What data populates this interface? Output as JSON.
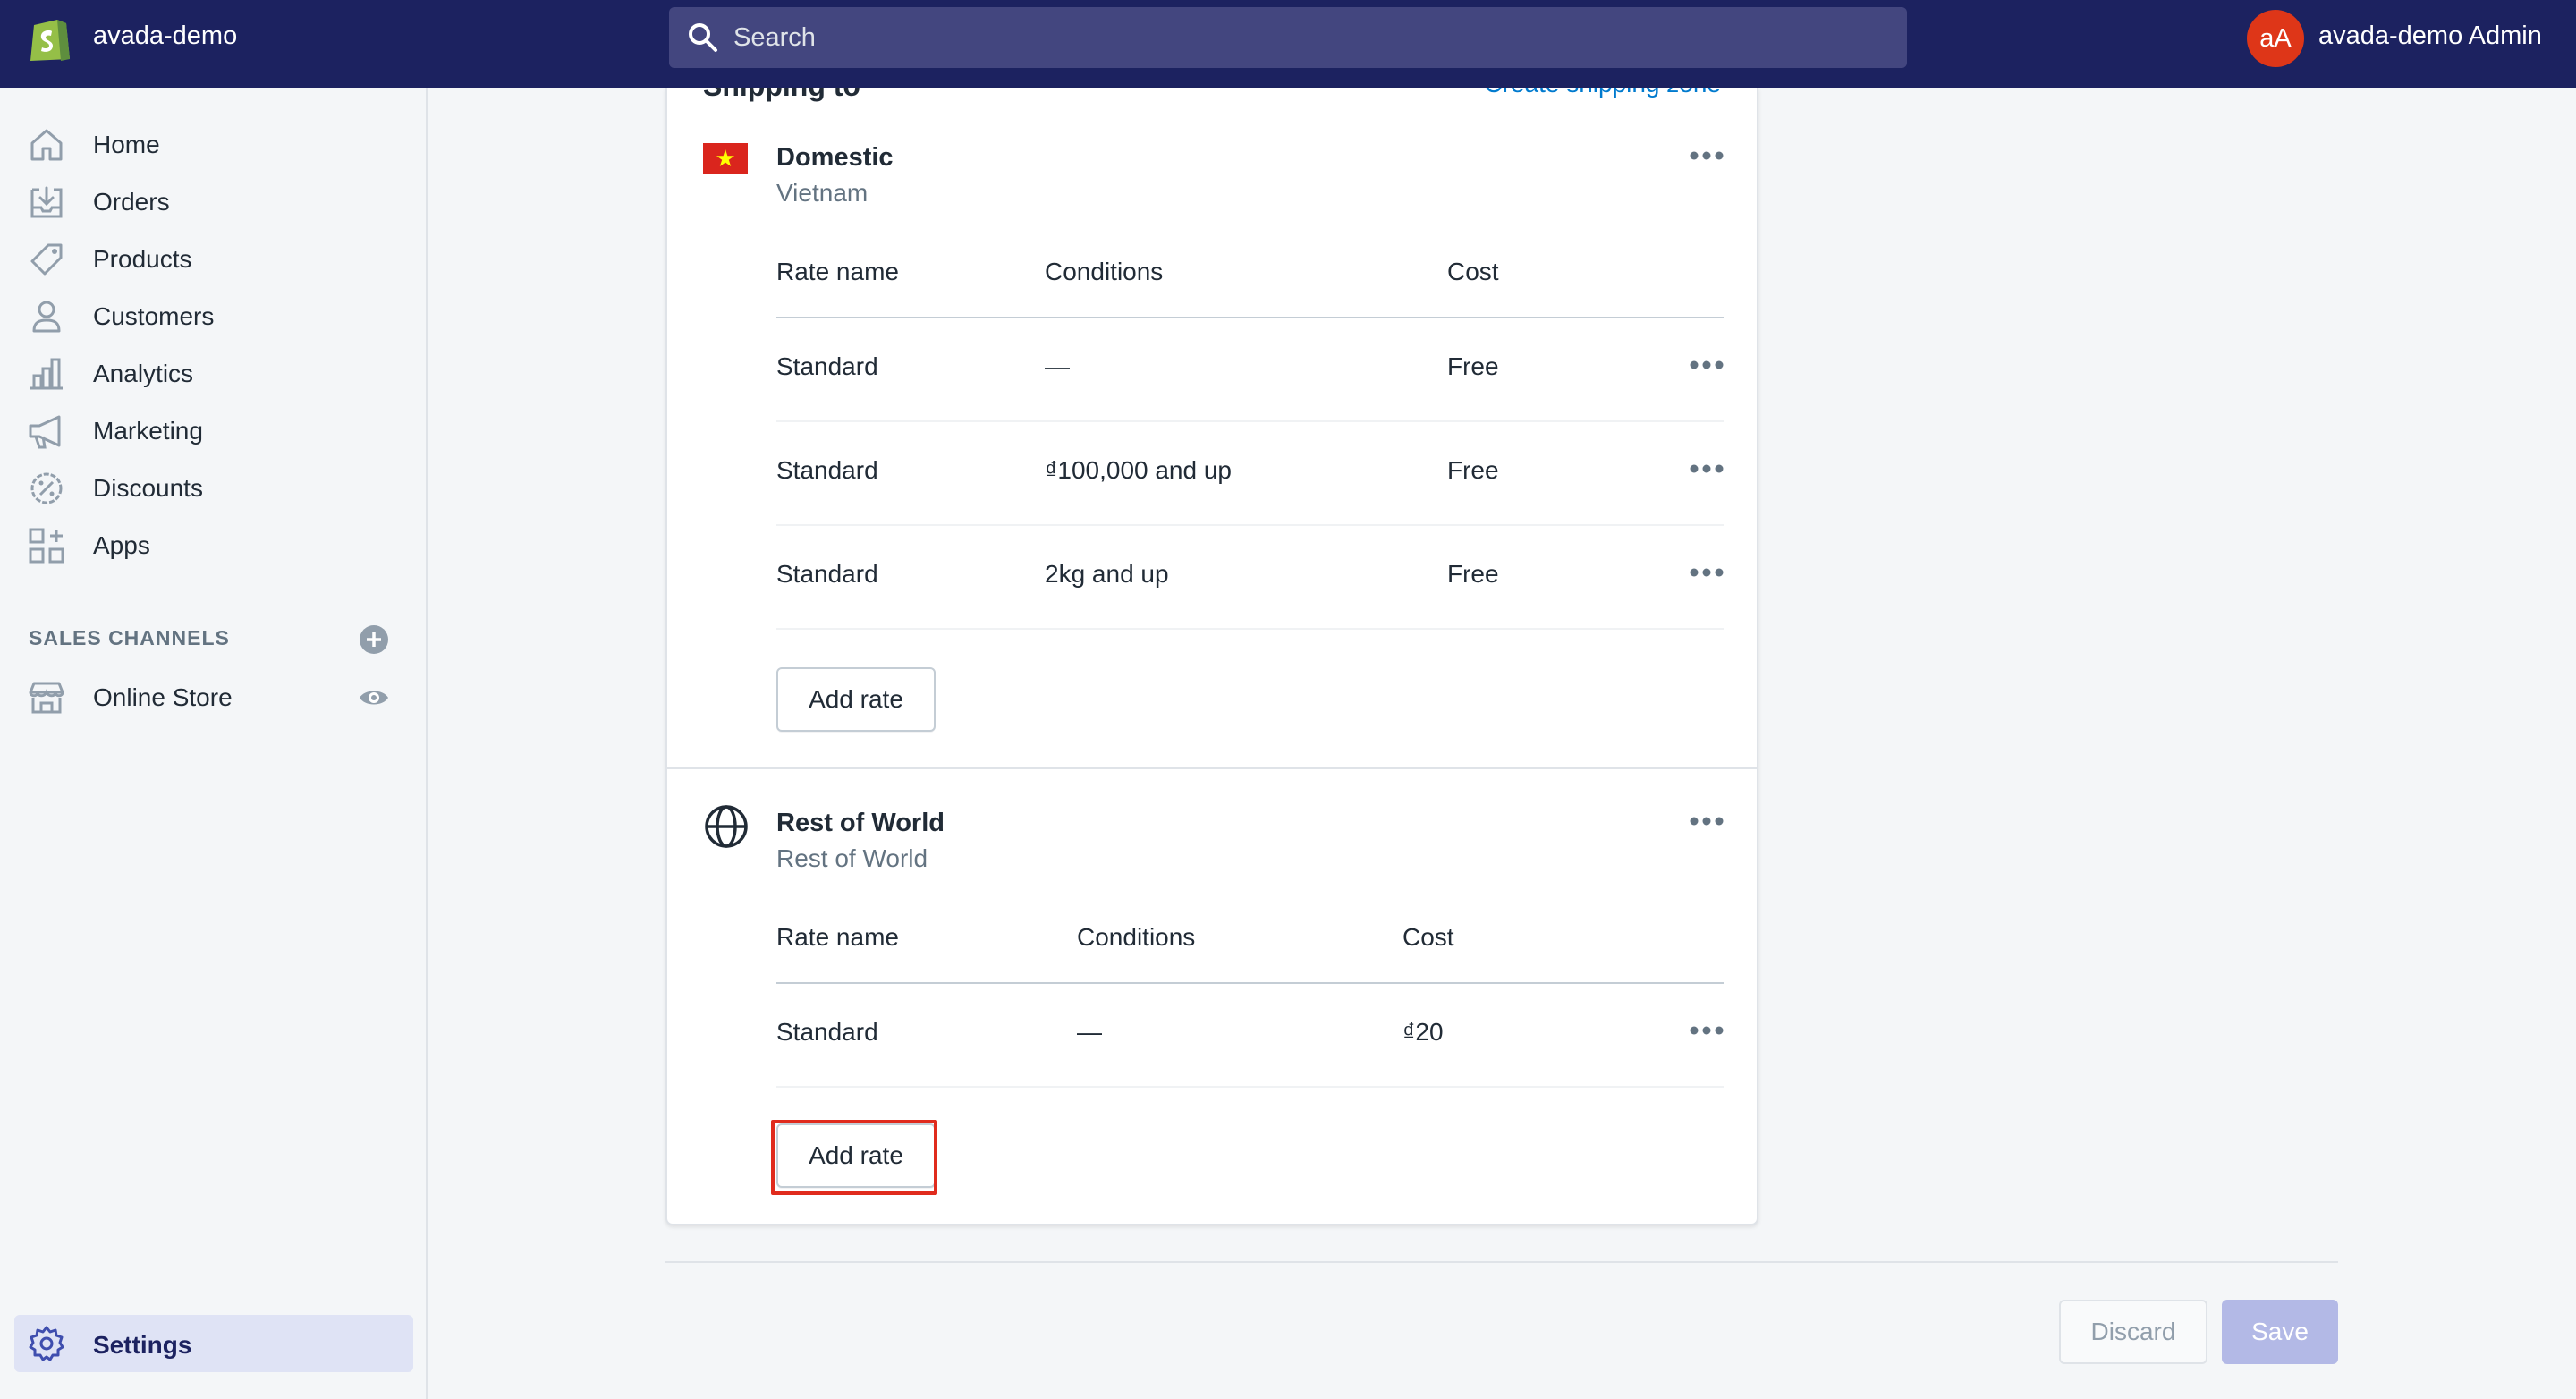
{
  "topbar": {
    "shop_name": "avada-demo",
    "search_placeholder": "Search",
    "avatar_initials": "aA",
    "admin_name": "avada-demo Admin"
  },
  "sidebar": {
    "items": [
      {
        "label": "Home",
        "icon": "home-icon"
      },
      {
        "label": "Orders",
        "icon": "orders-icon"
      },
      {
        "label": "Products",
        "icon": "tag-icon"
      },
      {
        "label": "Customers",
        "icon": "person-icon"
      },
      {
        "label": "Analytics",
        "icon": "bar-chart-icon"
      },
      {
        "label": "Marketing",
        "icon": "megaphone-icon"
      },
      {
        "label": "Discounts",
        "icon": "discount-icon"
      },
      {
        "label": "Apps",
        "icon": "apps-icon"
      }
    ],
    "sales_channels_title": "SALES CHANNELS",
    "online_store_label": "Online Store",
    "settings_label": "Settings"
  },
  "card": {
    "heading": "Shipping to",
    "create_zone_link": "Create shipping zone"
  },
  "zones": [
    {
      "title": "Domestic",
      "subtitle": "Vietnam",
      "headers": {
        "rate_name": "Rate name",
        "conditions": "Conditions",
        "cost": "Cost"
      },
      "rows": [
        {
          "name": "Standard",
          "condition": "—",
          "cost": "Free"
        },
        {
          "name": "Standard",
          "condition": "₫100,000 and up",
          "cost": "Free"
        },
        {
          "name": "Standard",
          "condition": "2kg and up",
          "cost": "Free"
        }
      ],
      "add_rate_label": "Add rate"
    },
    {
      "title": "Rest of World",
      "subtitle": "Rest of World",
      "headers": {
        "rate_name": "Rate name",
        "conditions": "Conditions",
        "cost": "Cost"
      },
      "rows": [
        {
          "name": "Standard",
          "condition": "—",
          "cost": "₫20"
        }
      ],
      "add_rate_label": "Add rate"
    }
  ],
  "footer": {
    "discard_label": "Discard",
    "save_label": "Save"
  },
  "colors": {
    "topbar": "#1c2260",
    "highlight": "#e02b1d",
    "link": "#007ace",
    "save_disabled": "#b3b9e6"
  }
}
